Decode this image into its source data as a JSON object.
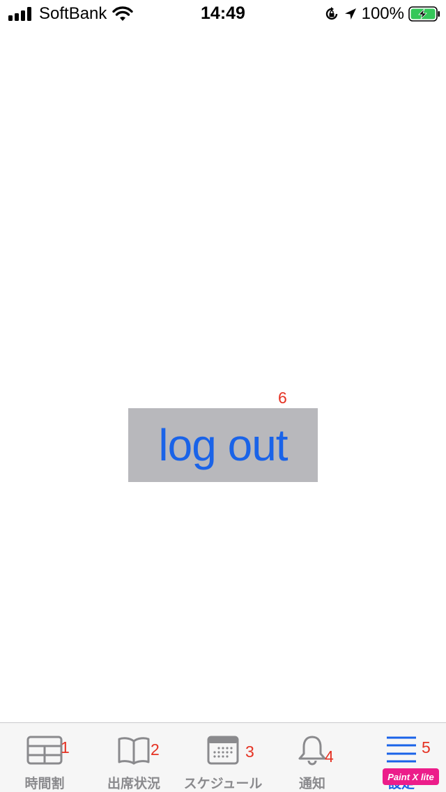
{
  "status_bar": {
    "carrier": "SoftBank",
    "time": "14:49",
    "battery": "100%"
  },
  "main": {
    "logout_label": "log out",
    "annotation": "6"
  },
  "tab_bar": {
    "tabs": [
      {
        "label": "時間割",
        "number": "1",
        "icon": "grid-icon"
      },
      {
        "label": "出席状況",
        "number": "2",
        "icon": "book-icon"
      },
      {
        "label": "スケジュール",
        "number": "3",
        "icon": "calendar-icon"
      },
      {
        "label": "通知",
        "number": "4",
        "icon": "bell-icon"
      },
      {
        "label": "設定",
        "number": "5",
        "icon": "menu-lines-icon"
      }
    ]
  },
  "watermark": "Paint X lite",
  "colors": {
    "button_bg": "#b8b8bc",
    "button_text": "#1a63e8",
    "annotation": "#e53223",
    "active_tab": "#1a63e8",
    "inactive_tab": "#8a8a8d"
  }
}
